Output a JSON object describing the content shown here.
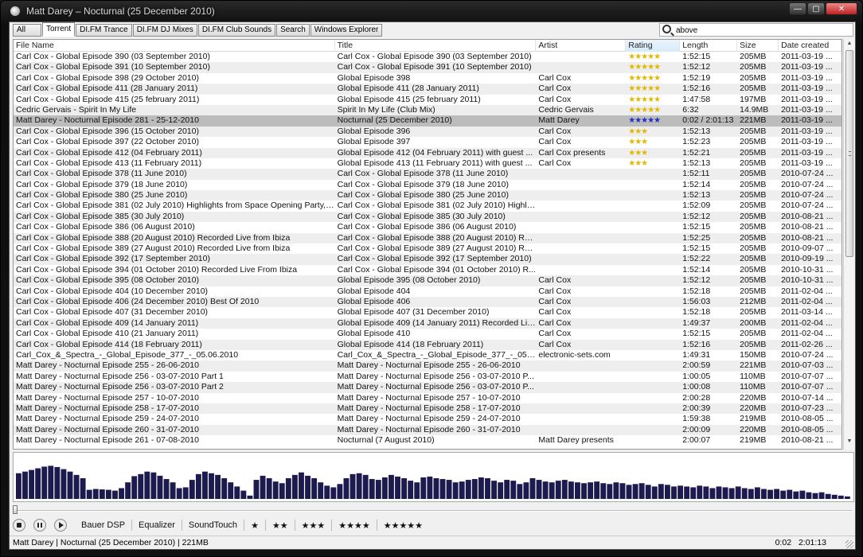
{
  "window": {
    "title": "Matt Darey  – Nocturnal (25 December 2010)",
    "controls": [
      "—",
      "▢",
      "✕"
    ]
  },
  "tabs": [
    {
      "label": "All",
      "active": false
    },
    {
      "label": "Torrent",
      "active": true
    },
    {
      "label": "DI.FM Trance",
      "active": false
    },
    {
      "label": "DI.FM DJ Mixes",
      "active": false
    },
    {
      "label": "DI.FM Club Sounds",
      "active": false
    },
    {
      "label": "Search",
      "active": false
    },
    {
      "label": "Windows Explorer",
      "active": false
    }
  ],
  "search": {
    "value": "above",
    "icon": "search-icon"
  },
  "columns": [
    "File Name",
    "Title",
    "Artist",
    "Rating",
    "Length",
    "Size",
    "Date created"
  ],
  "sorted_column": "Rating",
  "rows": [
    [
      "Carl Cox - Global Episode 390 (03 September 2010)",
      "Carl Cox - Global Episode 390 (03 September 2010)",
      "",
      "★★★★★",
      "1:52:15",
      "205MB",
      "2011-03-19 ..."
    ],
    [
      "Carl Cox - Global Episode 391 (10 September 2010)",
      "Carl Cox - Global Episode 391 (10 September 2010)",
      "",
      "★★★★★",
      "1:52:12",
      "205MB",
      "2011-03-19 ..."
    ],
    [
      "Carl Cox - Global Episode 398 (29 October 2010)",
      "Global Episode 398",
      "Carl Cox",
      "★★★★★",
      "1:52:19",
      "205MB",
      "2011-03-19 ..."
    ],
    [
      "Carl Cox - Global Episode 411 (28 January 2011)",
      "Global Episode 411 (28 January 2011)",
      "Carl Cox",
      "★★★★★",
      "1:52:16",
      "205MB",
      "2011-03-19 ..."
    ],
    [
      "Carl Cox - Global Episode 415 (25 february 2011)",
      "Global Episode 415 (25 february 2011)",
      "Carl Cox",
      "★★★★★",
      "1:47:58",
      "197MB",
      "2011-03-19 ..."
    ],
    [
      "Cedric Gervais - Spirit In My Life",
      "Spirit In My Life (Club Mix)",
      "Cedric Gervais",
      "★★★★★",
      "6:32",
      "14.9MB",
      "2011-03-19 ..."
    ],
    [
      "Matt Darey - Nocturnal Episode 281 - 25-12-2010",
      "Nocturnal (25 December 2010)",
      "Matt Darey",
      "★★★★★",
      "0:02 / 2:01:13",
      "221MB",
      "2011-03-19 ..."
    ],
    [
      "Carl Cox - Global Episode 396 (15 October 2010)",
      "Global Episode 396",
      "Carl Cox",
      "★★★",
      "1:52:13",
      "205MB",
      "2011-03-19 ..."
    ],
    [
      "Carl Cox - Global Episode 397 (22 October 2010)",
      "Global Episode 397",
      "Carl Cox",
      "★★★",
      "1:52:23",
      "205MB",
      "2011-03-19 ..."
    ],
    [
      "Carl Cox - Global Episode 412 (04 February 2011)",
      "Global Episode 412 (04 February 2011) with guest ...",
      "Carl Cox presents",
      "★★★",
      "1:52:21",
      "205MB",
      "2011-03-19 ..."
    ],
    [
      "Carl Cox - Global Episode 413 (11 February 2011)",
      "Global Episode 413 (11 February 2011) with guest ...",
      "Carl Cox",
      "★★★",
      "1:52:13",
      "205MB",
      "2011-03-19 ..."
    ],
    [
      "Carl Cox - Global Episode 378 (11 June 2010)",
      "Carl Cox - Global Episode 378 (11 June 2010)",
      "",
      "",
      "1:52:11",
      "205MB",
      "2010-07-24 ..."
    ],
    [
      "Carl Cox - Global Episode 379 (18 June 2010)",
      "Carl Cox - Global Episode 379 (18 June 2010)",
      "",
      "",
      "1:52:14",
      "205MB",
      "2010-07-24 ..."
    ],
    [
      "Carl Cox - Global Episode 380 (25 June 2010)",
      "Carl Cox - Global Episode 380 (25 June 2010)",
      "",
      "",
      "1:52:13",
      "205MB",
      "2010-07-24 ..."
    ],
    [
      "Carl Cox - Global Episode 381 (02 July 2010) Highlights from Space Opening Party, Ib...",
      "Carl Cox - Global Episode 381 (02 July 2010) Highlig...",
      "",
      "",
      "1:52:09",
      "205MB",
      "2010-07-24 ..."
    ],
    [
      "Carl Cox - Global Episode 385 (30 July 2010)",
      "Carl Cox - Global Episode 385 (30 July 2010)",
      "",
      "",
      "1:52:12",
      "205MB",
      "2010-08-21 ..."
    ],
    [
      "Carl Cox - Global Episode 386 (06 August 2010)",
      "Carl Cox - Global Episode 386 (06 August 2010)",
      "",
      "",
      "1:52:15",
      "205MB",
      "2010-08-21 ..."
    ],
    [
      "Carl Cox - Global Episode 388 (20 August 2010) Recorded Live from Ibiza",
      "Carl Cox - Global Episode 388 (20 August 2010) Re...",
      "",
      "",
      "1:52:25",
      "205MB",
      "2010-08-21 ..."
    ],
    [
      "Carl Cox - Global Episode 389 (27 August 2010) Recorded Live from Ibiza",
      "Carl Cox - Global Episode 389 (27 August 2010) Re...",
      "",
      "",
      "1:52:15",
      "205MB",
      "2010-09-07 ..."
    ],
    [
      "Carl Cox - Global Episode 392 (17 September 2010)",
      "Carl Cox - Global Episode 392 (17 September 2010)",
      "",
      "",
      "1:52:22",
      "205MB",
      "2010-09-19 ..."
    ],
    [
      "Carl Cox - Global Episode 394 (01 October 2010) Recorded Live From Ibiza",
      "Carl Cox - Global Episode 394 (01 October 2010) R...",
      "",
      "",
      "1:52:14",
      "205MB",
      "2010-10-31 ..."
    ],
    [
      "Carl Cox - Global Episode 395 (08 October 2010)",
      "Global Episode 395 (08 October 2010)",
      "Carl Cox",
      "",
      "1:52:12",
      "205MB",
      "2010-10-31 ..."
    ],
    [
      "Carl Cox - Global Episode 404 (10 December 2010)",
      "Global Episode 404",
      "Carl Cox",
      "",
      "1:52:18",
      "205MB",
      "2011-02-04 ..."
    ],
    [
      "Carl Cox - Global Episode 406 (24 December 2010) Best Of 2010",
      "Global Episode 406",
      "Carl Cox",
      "",
      "1:56:03",
      "212MB",
      "2011-02-04 ..."
    ],
    [
      "Carl Cox - Global Episode 407 (31 December 2010)",
      "Global Episode 407 (31 December 2010)",
      "Carl Cox",
      "",
      "1:52:18",
      "205MB",
      "2011-03-14 ..."
    ],
    [
      "Carl Cox - Global Episode 409 (14 January 2011)",
      "Global Episode 409 (14 January 2011) Recorded Liv...",
      "Carl Cox",
      "",
      "1:49:37",
      "200MB",
      "2011-02-04 ..."
    ],
    [
      "Carl Cox - Global Episode 410 (21 January 2011)",
      "Global Episode 410",
      "Carl Cox",
      "",
      "1:52:15",
      "205MB",
      "2011-02-04 ..."
    ],
    [
      "Carl Cox - Global Episode 414 (18 February 2011)",
      "Global Episode 414 (18 February 2011)",
      "Carl Cox",
      "",
      "1:52:16",
      "205MB",
      "2011-02-26 ..."
    ],
    [
      "Carl_Cox_&_Spectra_-_Global_Episode_377_-_05.06.2010",
      "Carl_Cox_&_Spectra_-_Global_Episode_377_-_05.0...",
      "electronic-sets.com",
      "",
      "1:49:31",
      "150MB",
      "2010-07-24 ..."
    ],
    [
      "Matt Darey - Nocturnal Episode 255 - 26-06-2010",
      "Matt Darey - Nocturnal Episode 255 - 26-06-2010",
      "",
      "",
      "2:00:59",
      "221MB",
      "2010-07-03 ..."
    ],
    [
      "Matt Darey - Nocturnal Episode 256 - 03-07-2010 Part 1",
      "Matt Darey - Nocturnal Episode 256 - 03-07-2010 P...",
      "",
      "",
      "1:00:05",
      "110MB",
      "2010-07-07 ..."
    ],
    [
      "Matt Darey - Nocturnal Episode 256 - 03-07-2010 Part 2",
      "Matt Darey - Nocturnal Episode 256 - 03-07-2010 P...",
      "",
      "",
      "1:00:08",
      "110MB",
      "2010-07-07 ..."
    ],
    [
      "Matt Darey - Nocturnal Episode 257 - 10-07-2010",
      "Matt Darey - Nocturnal Episode 257 - 10-07-2010",
      "",
      "",
      "2:00:28",
      "220MB",
      "2010-07-14 ..."
    ],
    [
      "Matt Darey - Nocturnal Episode 258 - 17-07-2010",
      "Matt Darey - Nocturnal Episode 258 - 17-07-2010",
      "",
      "",
      "2:00:39",
      "220MB",
      "2010-07-23 ..."
    ],
    [
      "Matt Darey - Nocturnal Episode 259 - 24-07-2010",
      "Matt Darey - Nocturnal Episode 259 - 24-07-2010",
      "",
      "",
      "1:59:38",
      "219MB",
      "2010-08-05 ..."
    ],
    [
      "Matt Darey - Nocturnal Episode 260 - 31-07-2010",
      "Matt Darey - Nocturnal Episode 260 - 31-07-2010",
      "",
      "",
      "2:00:09",
      "220MB",
      "2010-08-05 ..."
    ],
    [
      "Matt Darey - Nocturnal Episode 261 - 07-08-2010",
      "Nocturnal (7 August 2010)",
      "Matt Darey presents",
      "",
      "2:00:07",
      "219MB",
      "2010-08-21 ..."
    ]
  ],
  "selected_row": 6,
  "visualizer": {
    "color": "#1c1a4e",
    "levels": [
      0.62,
      0.66,
      0.7,
      0.74,
      0.78,
      0.8,
      0.77,
      0.72,
      0.66,
      0.58,
      0.5,
      0.22,
      0.24,
      0.23,
      0.22,
      0.2,
      0.26,
      0.4,
      0.55,
      0.6,
      0.66,
      0.64,
      0.56,
      0.48,
      0.4,
      0.26,
      0.28,
      0.46,
      0.6,
      0.66,
      0.62,
      0.58,
      0.5,
      0.4,
      0.3,
      0.2,
      0.08,
      0.46,
      0.56,
      0.5,
      0.42,
      0.38,
      0.5,
      0.58,
      0.64,
      0.56,
      0.5,
      0.4,
      0.32,
      0.28,
      0.36,
      0.5,
      0.6,
      0.62,
      0.58,
      0.48,
      0.46,
      0.52,
      0.58,
      0.54,
      0.5,
      0.44,
      0.4,
      0.52,
      0.54,
      0.5,
      0.48,
      0.46,
      0.4,
      0.42,
      0.46,
      0.48,
      0.52,
      0.5,
      0.44,
      0.4,
      0.46,
      0.44,
      0.36,
      0.4,
      0.5,
      0.46,
      0.42,
      0.4,
      0.44,
      0.46,
      0.42,
      0.4,
      0.38,
      0.4,
      0.42,
      0.38,
      0.36,
      0.4,
      0.38,
      0.34,
      0.36,
      0.38,
      0.34,
      0.3,
      0.36,
      0.34,
      0.3,
      0.32,
      0.3,
      0.28,
      0.32,
      0.3,
      0.26,
      0.3,
      0.28,
      0.26,
      0.3,
      0.26,
      0.24,
      0.28,
      0.24,
      0.22,
      0.24,
      0.2,
      0.22,
      0.18,
      0.2,
      0.16,
      0.14,
      0.16,
      0.12,
      0.1,
      0.08,
      0.06
    ]
  },
  "seek": {
    "progress": 0.0003
  },
  "controls": {
    "stop_icon": "stop-icon",
    "pause_icon": "pause-icon",
    "play_icon": "play-icon",
    "buttons": [
      "Bauer DSP",
      "Equalizer",
      "SoundTouch"
    ],
    "star_buttons": [
      "★",
      "★★",
      "★★★",
      "★★★★",
      "★★★★★"
    ]
  },
  "status": {
    "left": "Matt Darey  | Nocturnal (25 December 2010)  | 221MB",
    "elapsed": "0:02",
    "total": "2:01:13"
  }
}
